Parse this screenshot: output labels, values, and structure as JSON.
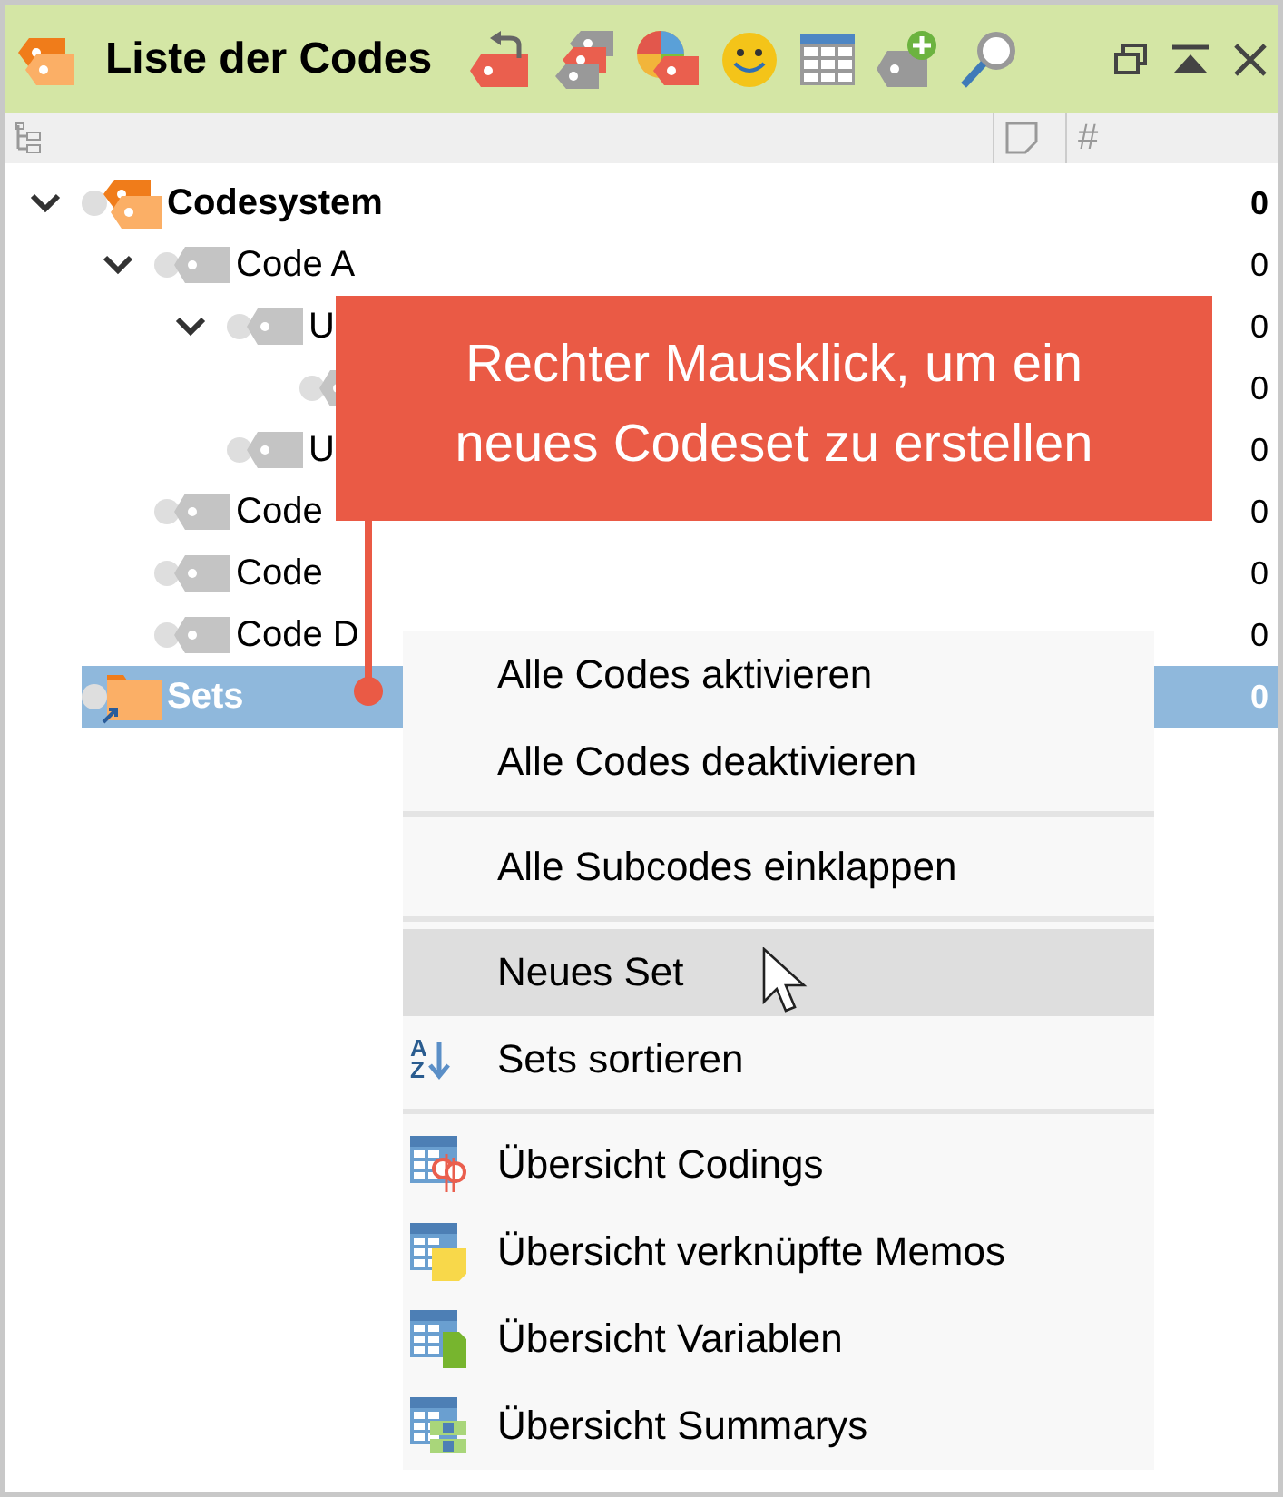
{
  "window": {
    "title": "Liste der Codes"
  },
  "columns": [
    {
      "kind": "tree"
    },
    {
      "kind": "memo"
    },
    {
      "kind": "count",
      "label": "#"
    }
  ],
  "tree": [
    {
      "kind": "codesystem",
      "name": "Codesystem",
      "count": "0",
      "expanded": true,
      "selected": false,
      "children": [
        {
          "kind": "code",
          "name": "Code A",
          "count": "0",
          "expanded": true,
          "selected": false,
          "children": [
            {
              "kind": "code",
              "name": "U",
              "count": "0",
              "expanded": true,
              "selected": false,
              "children": [
                {
                  "kind": "code",
                  "count": "0",
                  "selected": false
                }
              ]
            },
            {
              "kind": "code",
              "name": "U",
              "count": "0",
              "selected": false
            }
          ]
        },
        {
          "kind": "code",
          "name": "Code",
          "count": "0",
          "selected": false
        },
        {
          "kind": "code",
          "name": "Code",
          "count": "0",
          "selected": false
        },
        {
          "kind": "code",
          "name": "Code D",
          "count": "0",
          "selected": false
        }
      ]
    },
    {
      "kind": "set",
      "name": "Sets",
      "count": "0",
      "selected": true
    }
  ],
  "callout": {
    "text": "Rechter Mausklick, um ein\nneues Codeset zu erstellen"
  },
  "context_menu": {
    "items": [
      {
        "kind": "plain",
        "label": "Alle Codes aktivieren",
        "selected": false
      },
      {
        "kind": "plain",
        "label": "Alle Codes deaktivieren",
        "selected": false
      },
      {
        "kind": "separator"
      },
      {
        "kind": "plain",
        "label": "Alle Subcodes einklappen",
        "selected": false
      },
      {
        "kind": "separator"
      },
      {
        "kind": "plain",
        "label": "Neues Set",
        "selected": true
      },
      {
        "kind": "sort",
        "label": "Sets sortieren",
        "selected": false,
        "icon_letters": [
          "A",
          "Z"
        ]
      },
      {
        "kind": "separator"
      },
      {
        "kind": "codings",
        "label": "Übersicht Codings",
        "selected": false
      },
      {
        "kind": "memos",
        "label": "Übersicht verknüpfte Memos",
        "selected": false
      },
      {
        "kind": "variables",
        "label": "Übersicht Variablen",
        "selected": false
      },
      {
        "kind": "summaries",
        "label": "Übersicht Summarys",
        "selected": false
      }
    ]
  }
}
